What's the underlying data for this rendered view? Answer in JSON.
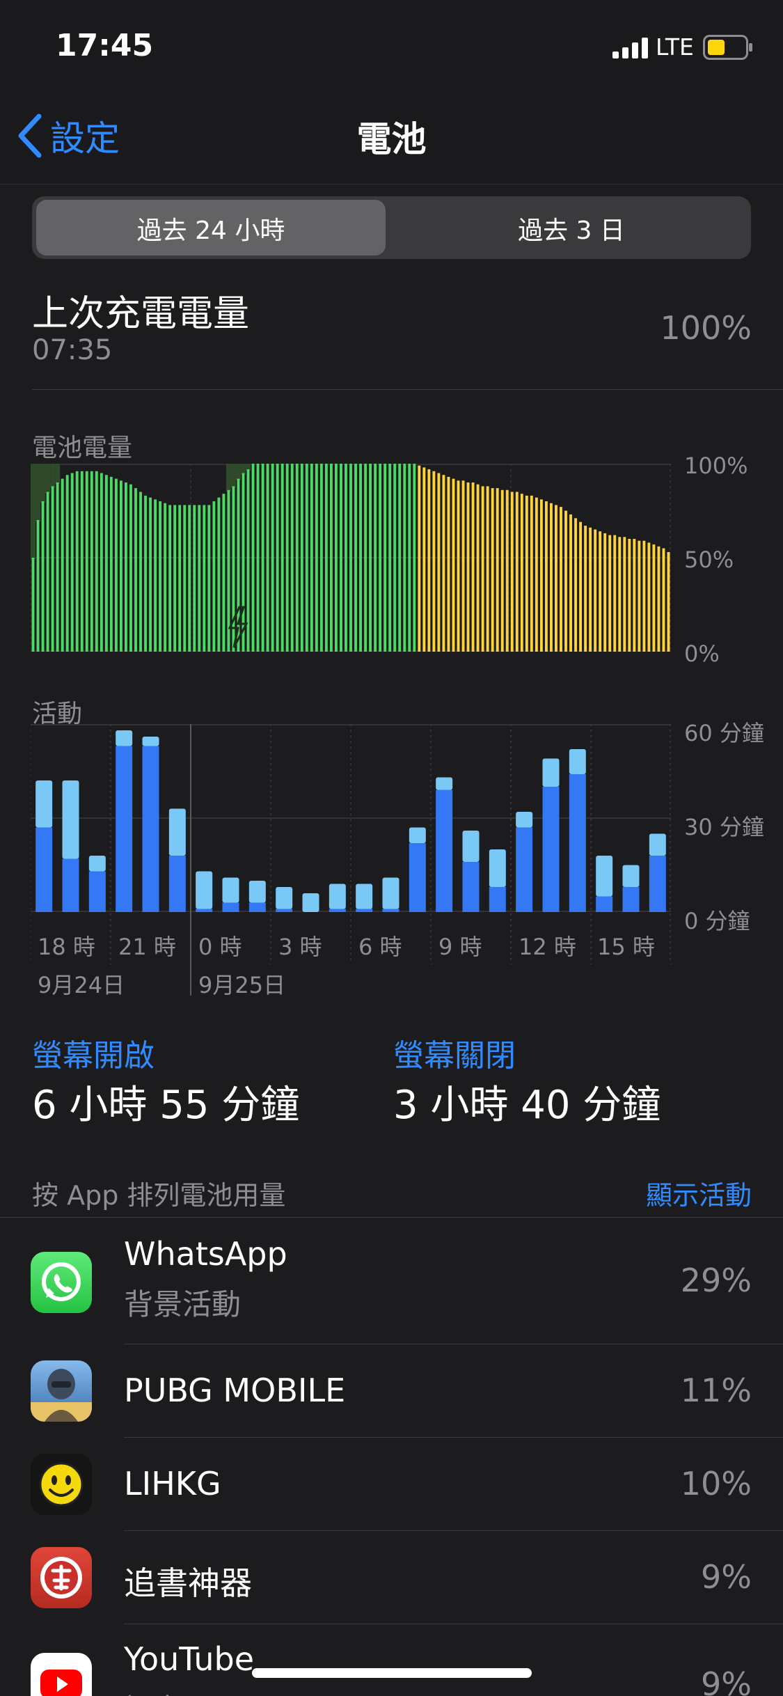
{
  "status_bar": {
    "time": "17:45",
    "network": "LTE"
  },
  "nav": {
    "back_label": "設定",
    "title": "電池"
  },
  "segmented": {
    "options": [
      "過去 24 小時",
      "過去 3 日"
    ],
    "selected": 0
  },
  "last_charge": {
    "title": "上次充電電量",
    "time": "07:35",
    "level": "100%"
  },
  "battery_chart": {
    "title": "電池電量",
    "y_labels": [
      "100%",
      "50%",
      "0%"
    ]
  },
  "activity_chart": {
    "title": "活動",
    "y_labels": [
      "60 分鐘",
      "30 分鐘",
      "0 分鐘"
    ],
    "x_labels": [
      "18 時",
      "21 時",
      "0 時",
      "3 時",
      "6 時",
      "9 時",
      "12 時",
      "15 時"
    ],
    "dates": [
      "9月24日",
      "9月25日"
    ]
  },
  "screen_on": {
    "label": "螢幕開啟",
    "value": "6 小時 55 分鐘"
  },
  "screen_off": {
    "label": "螢幕關閉",
    "value": "3 小時 40 分鐘"
  },
  "app_section": {
    "label": "按 App 排列電池用量",
    "action": "顯示活動"
  },
  "apps": [
    {
      "name": "WhatsApp",
      "subtitle": "背景活動",
      "percent": "29%",
      "icon": "whatsapp-icon",
      "color": "#2fd35a"
    },
    {
      "name": "PUBG MOBILE",
      "percent": "11%",
      "icon": "pubg-icon",
      "color": "#4a7fc1"
    },
    {
      "name": "LIHKG",
      "percent": "10%",
      "icon": "lihkg-smiley-icon",
      "color": "#f5d90a"
    },
    {
      "name": "追書神器",
      "percent": "9%",
      "icon": "book-reader-icon",
      "color": "#d63a2c"
    },
    {
      "name": "YouTube",
      "subtitle": "語音",
      "percent": "9%",
      "icon": "youtube-icon",
      "color": "#ff0000"
    }
  ],
  "colors": {
    "accent": "#2f8bff",
    "battery_green": "#4cd964",
    "battery_yellow": "#ffd43b",
    "activity_screen_on": "#3478f6",
    "activity_screen_off": "#7ac8f6"
  },
  "chart_data": [
    {
      "type": "bar",
      "title": "電池電量",
      "ylim": [
        0,
        100
      ],
      "y_unit": "%",
      "series": [
        {
          "values": [
            50,
            70,
            80,
            85,
            88,
            90,
            92,
            94,
            95,
            96,
            96,
            96,
            96,
            96,
            95,
            94,
            93,
            92,
            91,
            90,
            89,
            87,
            85,
            83,
            82,
            81,
            80,
            79,
            78,
            78,
            78,
            78,
            78,
            78,
            78,
            78,
            78,
            80,
            82,
            84,
            86,
            88,
            92,
            95,
            97,
            100,
            100,
            100,
            100,
            100,
            100,
            100,
            100,
            100,
            100,
            100,
            100,
            100,
            100,
            100,
            100,
            100,
            100,
            100,
            100,
            100,
            100,
            100,
            100,
            100,
            100,
            100,
            100,
            100,
            100,
            100,
            100,
            100,
            100,
            99,
            98,
            97,
            96,
            95,
            94,
            93,
            92,
            91,
            91,
            90,
            90,
            89,
            88,
            88,
            87,
            87,
            86,
            86,
            85,
            85,
            84,
            83,
            83,
            82,
            81,
            80,
            79,
            78,
            77,
            75,
            73,
            71,
            69,
            67,
            66,
            65,
            64,
            63,
            62,
            62,
            61,
            61,
            60,
            60,
            59,
            59,
            58,
            57,
            56,
            55,
            53
          ]
        }
      ],
      "charging_bars": [
        0,
        1,
        2,
        3,
        4,
        5,
        40,
        41,
        42,
        43,
        44
      ]
    },
    {
      "type": "bar",
      "title": "活動",
      "ylim": [
        0,
        60
      ],
      "y_unit": "分鐘",
      "categories": [
        "17",
        "18",
        "19",
        "20",
        "21",
        "22",
        "23",
        "0",
        "1",
        "2",
        "3",
        "4",
        "5",
        "6",
        "7",
        "8",
        "9",
        "10",
        "11",
        "12",
        "13",
        "14",
        "15",
        "16"
      ],
      "series": [
        {
          "values": [
            27,
            17,
            13,
            53,
            53,
            18,
            1,
            3,
            3,
            1,
            0,
            1,
            1,
            1,
            22,
            39,
            16,
            8,
            27,
            40,
            44,
            5,
            8,
            18
          ]
        },
        {
          "values": [
            15,
            25,
            5,
            5,
            3,
            15,
            12,
            8,
            7,
            7,
            6,
            8,
            8,
            10,
            5,
            4,
            10,
            12,
            5,
            9,
            8,
            13,
            7,
            7
          ]
        }
      ]
    }
  ]
}
